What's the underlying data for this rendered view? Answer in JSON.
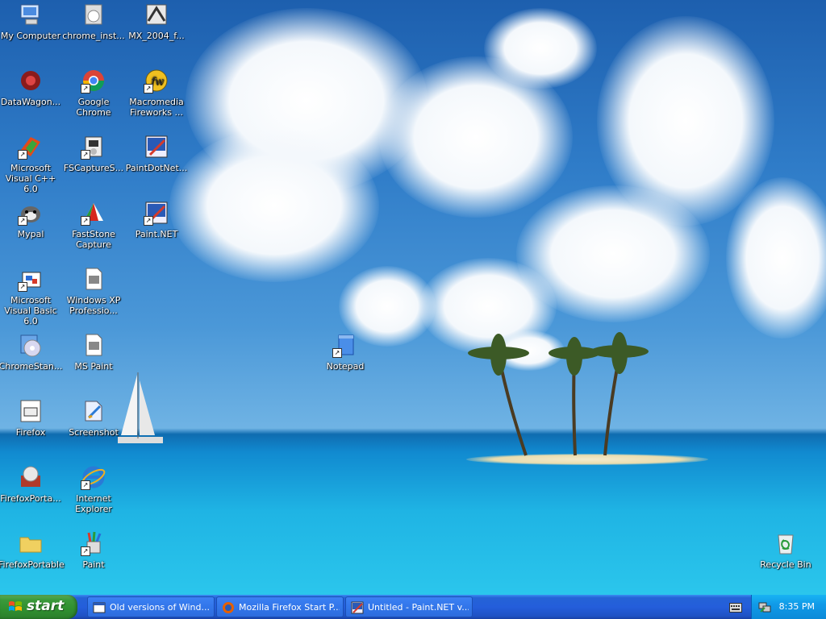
{
  "desktop": {
    "icons": [
      {
        "label": "My Computer",
        "icon": "my-computer-icon"
      },
      {
        "label": "chrome_inst...",
        "icon": "installer-icon"
      },
      {
        "label": "MX_2004_f...",
        "icon": "installer-icon"
      },
      {
        "label": "DataWagon...",
        "icon": "datawagon-icon"
      },
      {
        "label": "Google Chrome",
        "icon": "chrome-icon"
      },
      {
        "label": "Macromedia Fireworks ...",
        "icon": "fireworks-icon"
      },
      {
        "label": "Microsoft Visual C++ 6.0",
        "icon": "visual-cpp-icon"
      },
      {
        "label": "FSCaptureS...",
        "icon": "installer-icon"
      },
      {
        "label": "PaintDotNet...",
        "icon": "paintdotnet-icon"
      },
      {
        "label": "Mypal",
        "icon": "mypal-icon"
      },
      {
        "label": "FastStone Capture",
        "icon": "faststone-icon"
      },
      {
        "label": "Paint.NET",
        "icon": "paintdotnet-icon"
      },
      {
        "label": "Microsoft Visual Basic 6.0",
        "icon": "visual-basic-icon"
      },
      {
        "label": "Windows XP Professio...",
        "icon": "wmv-file-icon"
      },
      {
        "label": "ChromeStan...",
        "icon": "setup-cd-icon"
      },
      {
        "label": "MS Paint",
        "icon": "wmv-file-icon"
      },
      {
        "label": "Notepad",
        "icon": "notepad-icon"
      },
      {
        "label": "Firefox",
        "icon": "window-icon"
      },
      {
        "label": "Screenshot",
        "icon": "screenshot-icon"
      },
      {
        "label": "FirefoxPorta...",
        "icon": "firefox-portable-icon"
      },
      {
        "label": "Internet Explorer",
        "icon": "internet-explorer-icon"
      },
      {
        "label": "FirefoxPortable",
        "icon": "folder-icon"
      },
      {
        "label": "Paint",
        "icon": "paint-icon"
      },
      {
        "label": "Recycle Bin",
        "icon": "recycle-bin-icon"
      }
    ]
  },
  "taskbar": {
    "start_label": "start",
    "tasks": [
      {
        "label": "Old versions of Wind...",
        "icon": "window-icon"
      },
      {
        "label": "Mozilla Firefox Start P...",
        "icon": "firefox-icon"
      },
      {
        "label": "Untitled - Paint.NET v...",
        "icon": "paintdotnet-icon"
      }
    ],
    "clock": "8:35 PM"
  },
  "colors": {
    "taskbar_blue": "#245edb",
    "start_green": "#308f30",
    "tray_blue": "#109ae8"
  }
}
